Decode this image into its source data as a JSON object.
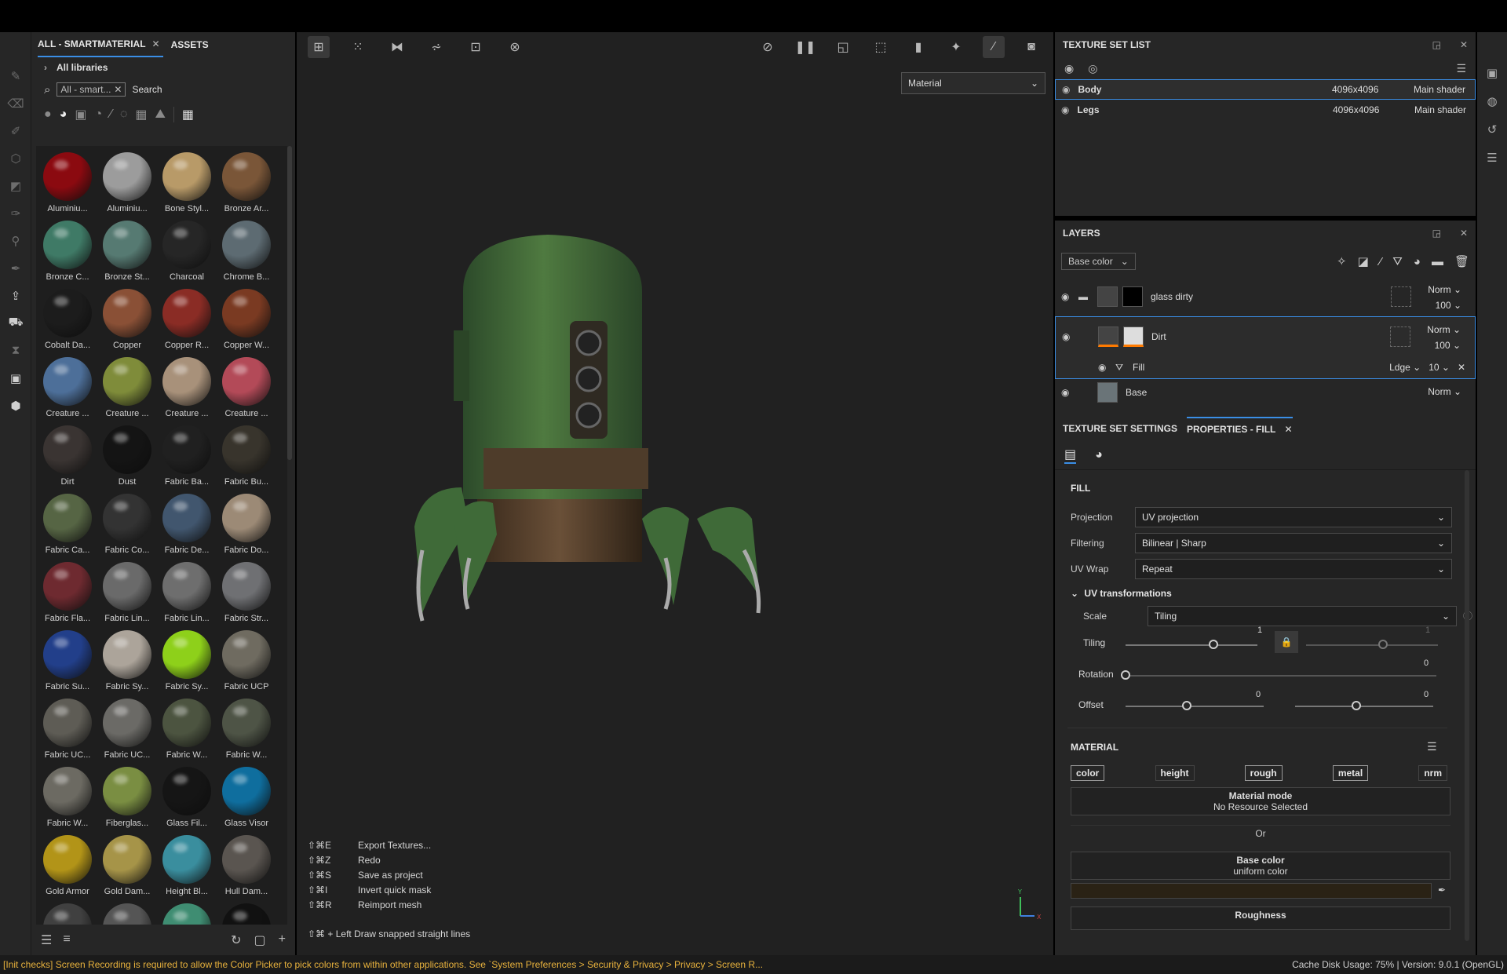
{
  "shelf": {
    "tabs": [
      {
        "label": "ALL - SMARTMATERIAL"
      },
      {
        "label": "ASSETS"
      }
    ],
    "breadcrumb": "All libraries",
    "search_chip": "All - smart...",
    "search_label": "Search",
    "materials": [
      {
        "label": "Aluminiu...",
        "color": "#8b0a10"
      },
      {
        "label": "Aluminiu...",
        "color": "#9c9c9c"
      },
      {
        "label": "Bone Styl...",
        "color": "#b89a68"
      },
      {
        "label": "Bronze Ar...",
        "color": "#7a5638"
      },
      {
        "label": "Bronze C...",
        "color": "#3f7a66"
      },
      {
        "label": "Bronze St...",
        "color": "#567a72"
      },
      {
        "label": "Charcoal",
        "color": "#262626"
      },
      {
        "label": "Chrome B...",
        "color": "#5d6b72"
      },
      {
        "label": "Cobalt Da...",
        "color": "#1c1c1c"
      },
      {
        "label": "Copper",
        "color": "#8a5036"
      },
      {
        "label": "Copper R...",
        "color": "#8a2c25"
      },
      {
        "label": "Copper W...",
        "color": "#7a3a22"
      },
      {
        "label": "Creature ...",
        "color": "#4d6f99"
      },
      {
        "label": "Creature ...",
        "color": "#7f8c3a"
      },
      {
        "label": "Creature ...",
        "color": "#a8917a"
      },
      {
        "label": "Creature ...",
        "color": "#b34a58"
      },
      {
        "label": "Dirt",
        "color": "#3a3432"
      },
      {
        "label": "Dust",
        "color": "#141414"
      },
      {
        "label": "Fabric Ba...",
        "color": "#202020"
      },
      {
        "label": "Fabric Bu...",
        "color": "#38342c"
      },
      {
        "label": "Fabric Ca...",
        "color": "#566544"
      },
      {
        "label": "Fabric Co...",
        "color": "#333333"
      },
      {
        "label": "Fabric De...",
        "color": "#41566e"
      },
      {
        "label": "Fabric Do...",
        "color": "#9c8a76"
      },
      {
        "label": "Fabric Fla...",
        "color": "#6e2a30"
      },
      {
        "label": "Fabric Lin...",
        "color": "#6a6a6a"
      },
      {
        "label": "Fabric Lin...",
        "color": "#6e6e6e"
      },
      {
        "label": "Fabric Str...",
        "color": "#6f7073"
      },
      {
        "label": "Fabric Su...",
        "color": "#223f8a"
      },
      {
        "label": "Fabric Sy...",
        "color": "#aca49a"
      },
      {
        "label": "Fabric Sy...",
        "color": "#8ed01a"
      },
      {
        "label": "Fabric UCP",
        "color": "#6f6b60"
      },
      {
        "label": "Fabric UC...",
        "color": "#5e5c55"
      },
      {
        "label": "Fabric UC...",
        "color": "#6b6a66"
      },
      {
        "label": "Fabric W...",
        "color": "#4c5440"
      },
      {
        "label": "Fabric W...",
        "color": "#4e5446"
      },
      {
        "label": "Fabric W...",
        "color": "#6c6a62"
      },
      {
        "label": "Fiberglas...",
        "color": "#7a8e42"
      },
      {
        "label": "Glass Fil...",
        "color": "#151515"
      },
      {
        "label": "Glass Visor",
        "color": "#0f6e9e"
      },
      {
        "label": "Gold Armor",
        "color": "#b29418"
      },
      {
        "label": "Gold Dam...",
        "color": "#a69448"
      },
      {
        "label": "Height Bl...",
        "color": "#3a8e9e"
      },
      {
        "label": "Hull Dam...",
        "color": "#5a5550"
      },
      {
        "label": "",
        "color": "#404040"
      },
      {
        "label": "",
        "color": "#555555"
      },
      {
        "label": "",
        "color": "#3f8d72"
      },
      {
        "label": "",
        "color": "#111111"
      }
    ]
  },
  "viewport": {
    "material_select": "Material",
    "shortcuts": [
      {
        "key": "⇧⌘E",
        "action": "Export Textures..."
      },
      {
        "key": "⇧⌘Z",
        "action": "Redo"
      },
      {
        "key": "⇧⌘S",
        "action": "Save as project"
      },
      {
        "key": "⇧⌘I",
        "action": "Invert quick mask"
      },
      {
        "key": "⇧⌘R",
        "action": "Reimport mesh"
      }
    ],
    "snap_hint": "⇧⌘ + Left  Draw snapped straight lines"
  },
  "texture_set_list": {
    "title": "TEXTURE SET LIST",
    "rows": [
      {
        "name": "Body",
        "res": "4096x4096",
        "shader": "Main shader"
      },
      {
        "name": "Legs",
        "res": "4096x4096",
        "shader": "Main shader"
      }
    ]
  },
  "layers": {
    "title": "LAYERS",
    "channel_select": "Base color",
    "items": [
      {
        "name": "glass dirty",
        "blend": "Norm",
        "opacity": "100"
      },
      {
        "name": "Dirt",
        "blend": "Norm",
        "opacity": "100"
      },
      {
        "name": "Fill",
        "blend": "Ldge",
        "opacity": "10"
      },
      {
        "name": "Base",
        "blend": "Norm",
        "opacity": ""
      }
    ]
  },
  "properties": {
    "tab_settings": "TEXTURE SET SETTINGS",
    "tab_fill": "PROPERTIES - FILL",
    "fill_title": "FILL",
    "projection_label": "Projection",
    "projection": "UV projection",
    "filtering_label": "Filtering",
    "filtering": "Bilinear | Sharp",
    "uvwrap_label": "UV Wrap",
    "uvwrap": "Repeat",
    "uvt_title": "UV transformations",
    "scale_label": "Scale",
    "scale": "Tiling",
    "tiling_label": "Tiling",
    "tiling_a": "1",
    "tiling_b": "1",
    "rotation_label": "Rotation",
    "rotation": "0",
    "offset_label": "Offset",
    "offset_a": "0",
    "offset_b": "0",
    "material_title": "MATERIAL",
    "channels": [
      "color",
      "height",
      "rough",
      "metal",
      "nrm"
    ],
    "material_mode": "Material mode",
    "no_resource": "No Resource Selected",
    "or": "Or",
    "base_color": "Base color",
    "uniform": "uniform color",
    "roughness": "Roughness",
    "base_swatch": "#2a2215"
  },
  "status": {
    "warning": "[Init checks] Screen Recording is required to allow the Color Picker to pick colors from within other applications. See `System Preferences > Security & Privacy > Privacy > Screen R...",
    "info": "Cache Disk Usage:     75% | Version: 9.0.1 (OpenGL)"
  }
}
